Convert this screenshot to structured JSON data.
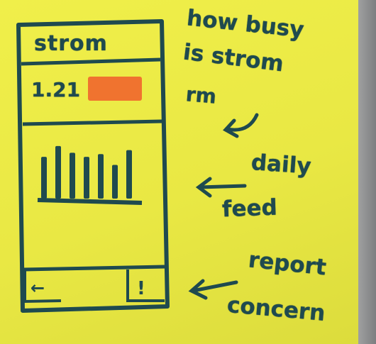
{
  "phone": {
    "app_title": "strom",
    "busyness_value": "1.21",
    "busyness_bar_color": "#f0732f",
    "feed_bars": [
      0.62,
      0.78,
      0.68,
      0.62,
      0.66,
      0.5,
      0.72
    ],
    "back_icon": "arrow-left-icon",
    "concern_icon": "exclamation-icon"
  },
  "annotations": {
    "line1": "how busy",
    "line2": "is strom",
    "line3": "rm",
    "feed_1": "daily",
    "feed_2": "feed",
    "report_1": "report",
    "report_2": "concern"
  },
  "colors": {
    "ink": "#1f4a4f",
    "paper": "#ecec46",
    "highlight": "#f0732f"
  }
}
